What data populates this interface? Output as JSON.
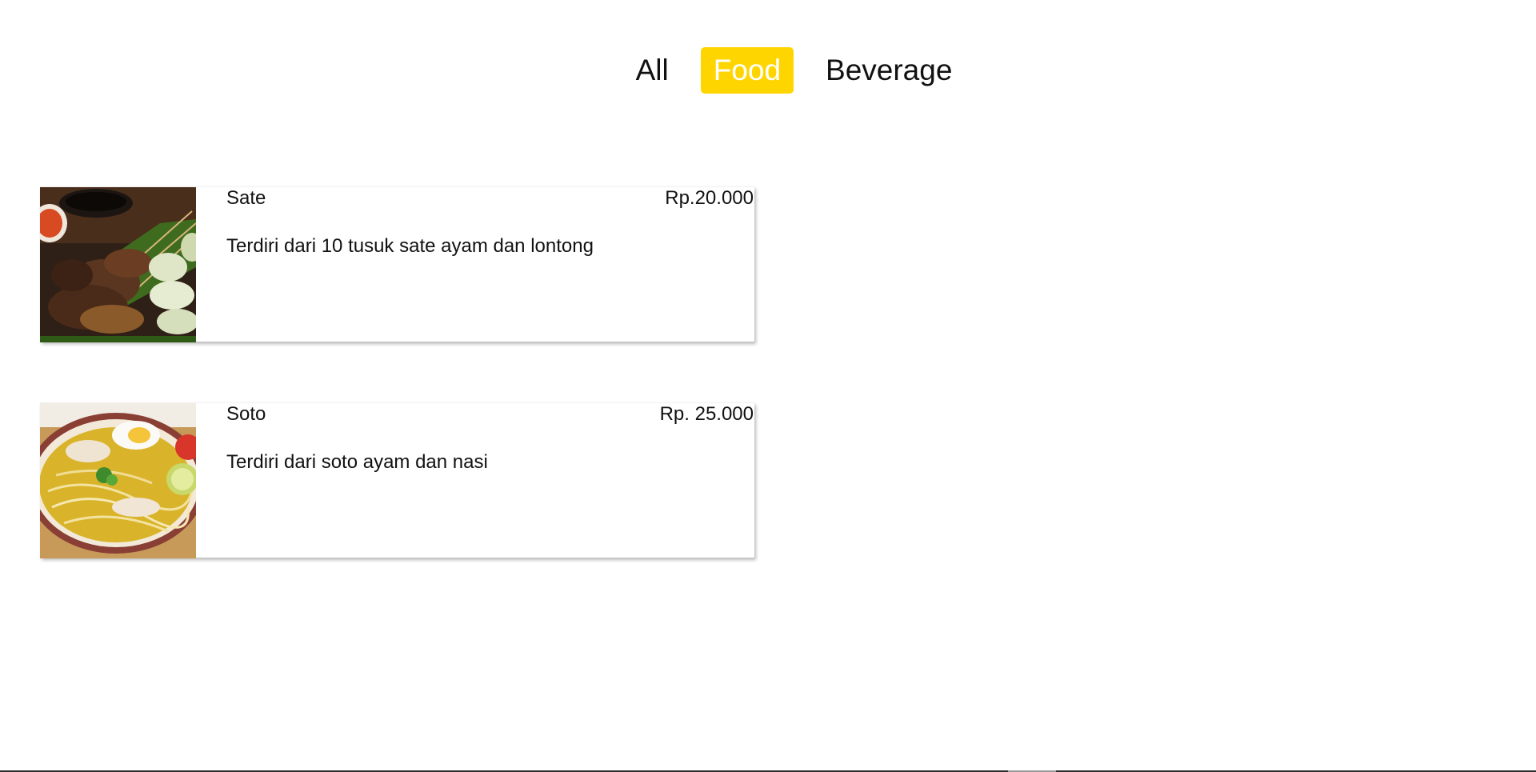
{
  "filters": {
    "tabs": [
      {
        "label": "All",
        "active": false
      },
      {
        "label": "Food",
        "active": true
      },
      {
        "label": "Beverage",
        "active": false
      }
    ],
    "active_color": "#ffd500"
  },
  "menu": {
    "items": [
      {
        "name": "Sate",
        "price": "Rp.20.000",
        "description": "Terdiri dari 10 tusuk sate ayam dan lontong",
        "image": "sate-photo"
      },
      {
        "name": "Soto",
        "price": "Rp. 25.000",
        "description": "Terdiri dari soto ayam dan nasi",
        "image": "soto-photo"
      }
    ]
  }
}
